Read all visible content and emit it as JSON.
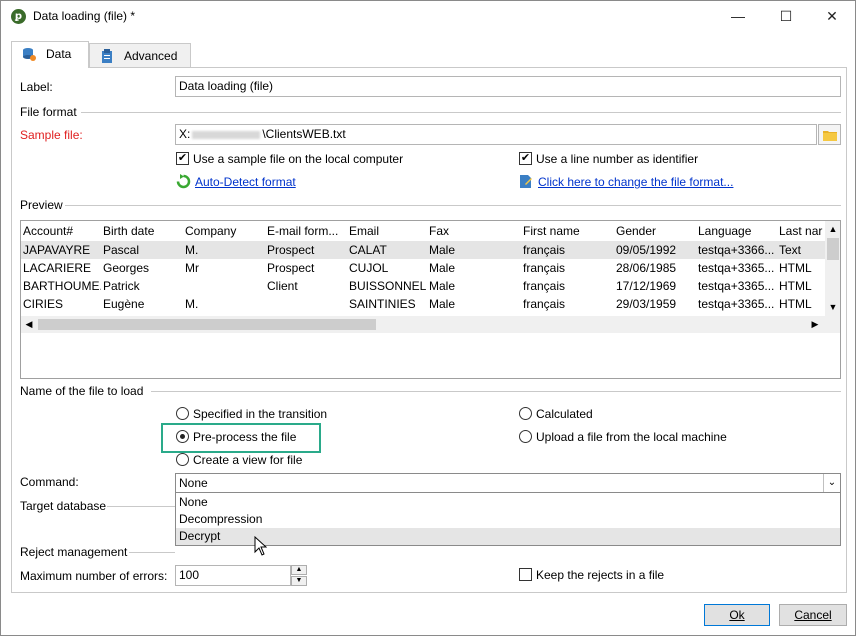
{
  "window": {
    "title": "Data loading (file) *",
    "minimize": "—",
    "maximize": "☐",
    "close": "✕"
  },
  "tabs": {
    "data": "Data",
    "advanced": "Advanced"
  },
  "form": {
    "label_label": "Label:",
    "label_value": "Data loading (file)",
    "file_format_section": "File format",
    "sample_file_label": "Sample file:",
    "sample_file_value_prefix": "X:",
    "sample_file_value_suffix": "\\ClientsWEB.txt",
    "use_sample_local": "Use a sample file on the local computer",
    "use_line_number": "Use a line number as identifier",
    "auto_detect": "Auto-Detect format",
    "change_format": "Click here to change the file format..."
  },
  "preview": {
    "section": "Preview",
    "columns": [
      "Account#",
      "Birth date",
      "Company",
      "E-mail form...",
      "Email",
      "Fax",
      "First name",
      "Gender",
      "Language",
      "Last nar"
    ],
    "rows": [
      [
        "JAPAVAYRE",
        "Pascal",
        "M.",
        "Prospect",
        "CALAT",
        "Male",
        "français",
        "09/05/1992",
        "testqa+3366...",
        "Text"
      ],
      [
        "LACARIERE",
        "Georges",
        "Mr",
        "Prospect",
        "CUJOL",
        "Male",
        "français",
        "28/06/1985",
        "testqa+3365...",
        "HTML"
      ],
      [
        "BARTHOUME...",
        "Patrick",
        "",
        "Client",
        "BUISSONNEL",
        "Male",
        "français",
        "17/12/1969",
        "testqa+3365...",
        "HTML"
      ],
      [
        "CIRIES",
        "Eugène",
        "M.",
        "",
        "SAINTINIES",
        "Male",
        "français",
        "29/03/1959",
        "testqa+3365...",
        "HTML"
      ]
    ]
  },
  "file_to_load": {
    "section": "Name of the file to load",
    "specified": "Specified in the transition",
    "preprocess": "Pre-process the file",
    "create_view": "Create a view for file",
    "calculated": "Calculated",
    "upload_local": "Upload a file from the local machine"
  },
  "command": {
    "label": "Command:",
    "selected": "None",
    "options": [
      "None",
      "Decompression",
      "Decrypt"
    ]
  },
  "target_database": {
    "section": "Target database"
  },
  "reject": {
    "section": "Reject management",
    "max_errors_label": "Maximum number of errors:",
    "max_errors_value": "100",
    "keep_rejects": "Keep the rejects in a file"
  },
  "buttons": {
    "ok": "Ok",
    "cancel": "Cancel"
  },
  "colors": {
    "highlight_box": "#2aaa8a",
    "link": "#0033cc",
    "required": "#e02020"
  }
}
